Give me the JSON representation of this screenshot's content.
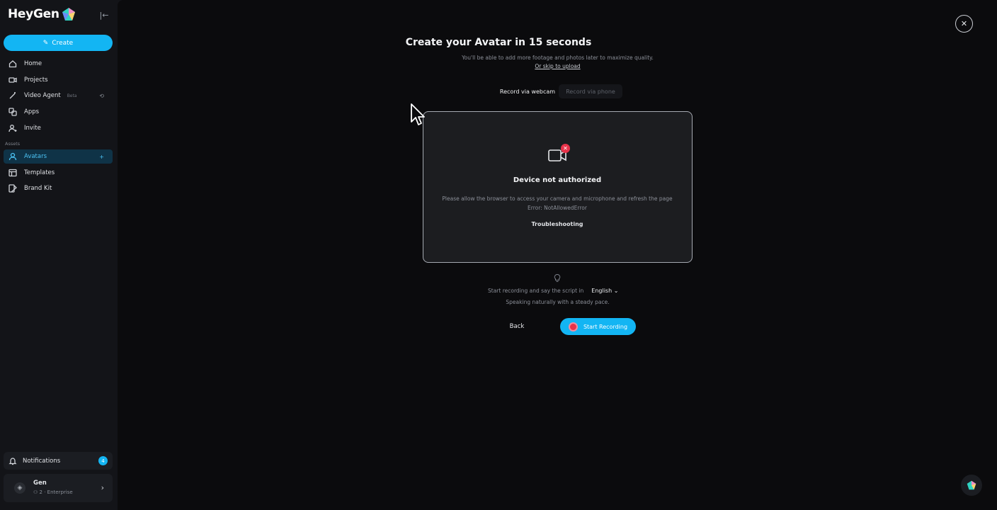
{
  "brand": {
    "name": "HeyGen"
  },
  "sidebar": {
    "create_label": "Create",
    "nav": [
      {
        "label": "Home",
        "icon": "home-icon"
      },
      {
        "label": "Projects",
        "icon": "video-icon"
      },
      {
        "label": "Video Agent",
        "badge": "Beta",
        "icon": "wand-icon"
      },
      {
        "label": "Apps",
        "icon": "apps-icon"
      },
      {
        "label": "Invite",
        "icon": "user-plus-icon"
      }
    ],
    "assets_label": "Assets",
    "assets": [
      {
        "label": "Avatars",
        "icon": "avatar-icon",
        "trail": "+",
        "active": true
      },
      {
        "label": "Templates",
        "icon": "template-icon"
      },
      {
        "label": "Brand Kit",
        "icon": "brand-kit-icon"
      }
    ],
    "notifications": {
      "label": "Notifications",
      "count": "4"
    },
    "account": {
      "name": "Gen",
      "members": "2",
      "plan": "· Enterprise"
    }
  },
  "main": {
    "title": "Create your Avatar in 15 seconds",
    "subtitle": "You'll be able to add more footage and photos later to maximize quality.",
    "skip_link": "Or skip to upload",
    "toggle": {
      "webcam": "Record via webcam",
      "phone": "Record via phone"
    },
    "box": {
      "title": "Device not authorized",
      "message": "Please allow the browser to access your camera and microphone and refresh the page",
      "error": "Error: NotAllowedError",
      "troubleshooting": "Troubleshooting"
    },
    "hint": {
      "prefix": "Start recording and say the script in",
      "language": "English",
      "second": "Speaking naturally with a steady pace."
    },
    "back_label": "Back",
    "record_label": "Start Recording"
  },
  "colors": {
    "accent": "#13b5f3",
    "danger": "#e8334a",
    "active_bg": "#0f3347"
  }
}
